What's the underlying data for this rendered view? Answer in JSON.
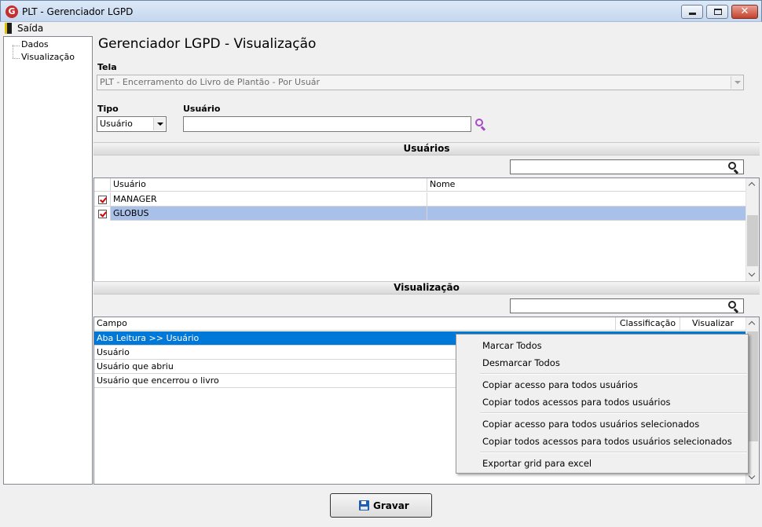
{
  "window": {
    "title": "PLT - Gerenciador LGPD",
    "app_icon_letter": "G"
  },
  "menu": {
    "exit_label": "Saída"
  },
  "tree": {
    "items": [
      {
        "label": "Dados"
      },
      {
        "label": "Visualização"
      }
    ]
  },
  "main": {
    "title": "Gerenciador LGPD - Visualização",
    "tela_label": "Tela",
    "tela_value": "PLT - Encerramento do Livro de Plantão - Por Usuár",
    "tipo_label": "Tipo",
    "tipo_value": "Usuário",
    "usuario_label": "Usuário",
    "usuario_value": ""
  },
  "usuarios_section": {
    "title": "Usuários",
    "search_value": "",
    "columns": [
      "Usuário",
      "Nome"
    ],
    "rows": [
      {
        "checked": true,
        "usuario": "MANAGER",
        "nome": "",
        "selected": false
      },
      {
        "checked": true,
        "usuario": "GLOBUS",
        "nome": "",
        "selected": true
      }
    ]
  },
  "visualizacao_section": {
    "title": "Visualização",
    "search_value": "",
    "columns": [
      "Campo",
      "Classificação",
      "Visualizar"
    ],
    "rows": [
      {
        "campo": "Aba Leitura >> Usuário",
        "selected": true
      },
      {
        "campo": "Usuário",
        "selected": false
      },
      {
        "campo": "Usuário que abriu",
        "selected": false
      },
      {
        "campo": "Usuário que encerrou o livro",
        "selected": false
      }
    ]
  },
  "context_menu": {
    "items": [
      "Marcar Todos",
      "Desmarcar Todos",
      "Copiar acesso para todos usuários",
      "Copiar todos acessos para todos usuários",
      "Copiar acesso para todos usuários selecionados",
      "Copiar todos acessos para todos usuários selecionados",
      "Exportar grid para excel"
    ]
  },
  "footer": {
    "save_label": "Gravar"
  },
  "colors": {
    "selection_blue": "#0078d7",
    "selection_light": "#a9c0e8",
    "checkmark_red": "#d40000",
    "search_accent": "#a64ac9"
  }
}
